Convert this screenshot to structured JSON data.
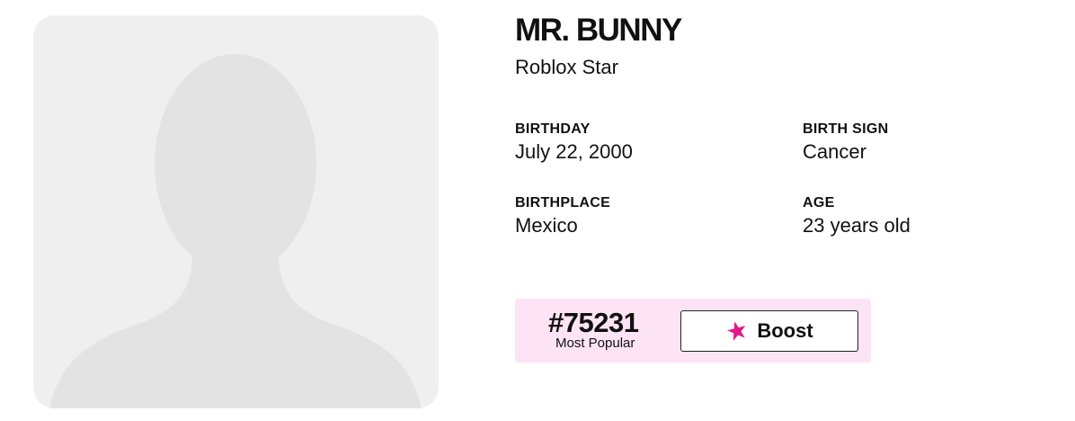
{
  "profile": {
    "name": "MR. BUNNY",
    "title": "Roblox Star",
    "facts": {
      "birthday": {
        "label": "BIRTHDAY",
        "value": "July 22, 2000"
      },
      "birth_sign": {
        "label": "BIRTH SIGN",
        "value": "Cancer"
      },
      "birthplace": {
        "label": "BIRTHPLACE",
        "value": "Mexico"
      },
      "age": {
        "label": "AGE",
        "value": "23 years old"
      }
    }
  },
  "ranking": {
    "rank": "#75231",
    "caption": "Most Popular",
    "boost_label": "Boost",
    "boost_icon": "star-icon"
  },
  "colors": {
    "avatar_bg": "#f0efef",
    "silhouette": "#e3e3e3",
    "rank_bg": "#fde4f4",
    "star": "#e0198a"
  }
}
